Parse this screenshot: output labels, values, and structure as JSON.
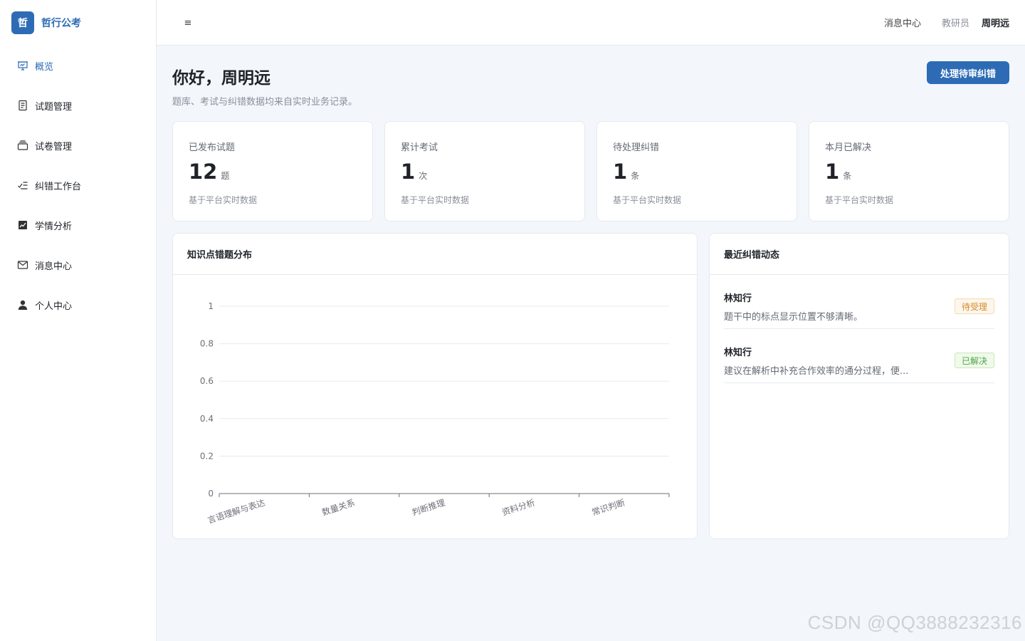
{
  "brand": {
    "logo_text": "哲",
    "name": "哲行公考"
  },
  "sidebar": {
    "items": [
      {
        "label": "概览",
        "icon": "presentation-icon"
      },
      {
        "label": "试题管理",
        "icon": "document-icon"
      },
      {
        "label": "试卷管理",
        "icon": "stack-icon"
      },
      {
        "label": "纠错工作台",
        "icon": "checklist-icon"
      },
      {
        "label": "学情分析",
        "icon": "chart-icon"
      },
      {
        "label": "消息中心",
        "icon": "mail-icon"
      },
      {
        "label": "个人中心",
        "icon": "user-icon"
      }
    ]
  },
  "topbar": {
    "menu_icon": "≡",
    "messages": "消息中心",
    "role": "教研员",
    "user": "周明远"
  },
  "header": {
    "greeting": "你好，周明远",
    "subtitle": "题库、考试与纠错数据均来自实时业务记录。",
    "action_button": "处理待审纠错"
  },
  "stats": [
    {
      "label": "已发布试题",
      "value": "12",
      "unit": "题",
      "note": "基于平台实时数据"
    },
    {
      "label": "累计考试",
      "value": "1",
      "unit": "次",
      "note": "基于平台实时数据"
    },
    {
      "label": "待处理纠错",
      "value": "1",
      "unit": "条",
      "note": "基于平台实时数据"
    },
    {
      "label": "本月已解决",
      "value": "1",
      "unit": "条",
      "note": "基于平台实时数据"
    }
  ],
  "chart_panel": {
    "title": "知识点错题分布"
  },
  "chart_data": {
    "type": "bar",
    "categories": [
      "言语理解与表达",
      "数量关系",
      "判断推理",
      "资料分析",
      "常识判断"
    ],
    "values": [
      0,
      0,
      0,
      0,
      0
    ],
    "ylim": [
      0,
      1
    ],
    "yticks": [
      "0",
      "0.2",
      "0.4",
      "0.6",
      "0.8",
      "1"
    ],
    "grid": true,
    "colors": {
      "grid": "#e6e9ef",
      "axis": "#6e7079",
      "label": "#6e7079"
    }
  },
  "activity_panel": {
    "title": "最近纠错动态",
    "items": [
      {
        "name": "林知行",
        "text": "题干中的标点显示位置不够清晰。",
        "status": "待受理",
        "status_type": "pending"
      },
      {
        "name": "林知行",
        "text": "建议在解析中补充合作效率的通分过程，便...",
        "status": "已解决",
        "status_type": "resolved"
      }
    ]
  },
  "watermark": "CSDN @QQ3888232316"
}
